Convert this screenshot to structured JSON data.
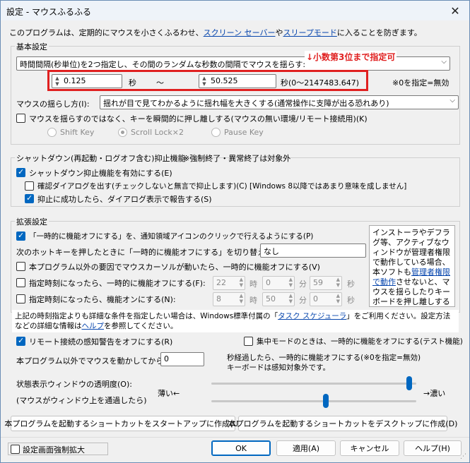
{
  "window": {
    "title": "設定 - マウスふるふる",
    "close_symbol": "✕"
  },
  "intro": {
    "text1": "このプログラムは、定期的にマウスを小さくふるわせ、",
    "link1": "スクリーン セーバー",
    "text2": "や",
    "link2": "スリープモード",
    "text3": "に入ることを防ぎます。"
  },
  "basic": {
    "label": "基本設定",
    "interval_combo": "時間間隔(秒単位)を2つ指定し、その間のランダムな秒数の間隔でマウスを揺らす:",
    "annotation": "↓小数第3位まで指定可",
    "min_value": "0.125",
    "sec_label": "秒",
    "tilde": "～",
    "max_value": "50.525",
    "range_label": "秒(0～2147483.647)",
    "zero_note": "※0を指定=無効",
    "shake_label": "マウスの揺らし方(I):",
    "shake_combo": "揺れが目で見てわかるように揺れ幅を大きくする(通常操作に支障が出る恐れあり)",
    "key_press_label": "マウスを揺らすのではなく、キーを瞬間的に押し離しする(マウスの無い環境/リモート接続用)(K)",
    "radio_shift": "Shift Key",
    "radio_scroll": "Scroll Lock×2",
    "radio_pause": "Pause Key"
  },
  "shutdown": {
    "label": "シャットダウン(再起動・ログオフ含む)抑止機能",
    "note": "※強制終了・異常終了は対象外",
    "enable_label": "シャットダウン抑止機能を有効にする(E)",
    "confirm_label": "確認ダイアログを出す(チェックしないと無言で抑止します)(C) [Windows 8以降ではあまり意味を成しません]",
    "report_label": "抑止に成功したら、ダイアログ表示で報告する(S)"
  },
  "ext": {
    "label": "拡張設定",
    "tray_label": "「一時的に機能オフにする」を、通知領域アイコンのクリックで行えるようにする(P)",
    "hotkey_label": "次のホットキーを押したときに「一時的に機能オフにする」を切り替える:",
    "hotkey_value": "なし",
    "cursor_label": "本プログラム以外の要因でマウスカーソルが動いたら、一時的に機能オフにする(V)",
    "off_time_label": "指定時刻になったら、一時的に機能オフにする(F):",
    "on_time_label": "指定時刻になったら、機能オンにする(N):",
    "off_h": "22",
    "off_m": "0",
    "off_s": "59",
    "on_h": "8",
    "on_m": "50",
    "on_s": "0",
    "unit_h": "時",
    "unit_m": "分",
    "unit_s": "秒",
    "note_text1": "インストーラやデフラグ等、アクティブなウィンドウが管理者権限で動作している場合、本ソフトも",
    "note_link": "管理者権限で動作",
    "note_text2": "させないと、マウスを揺らしたりキーボードを押し離しする機能や、左記のホットキー機能は動作しません。",
    "info_text1": "上記の時刻指定よりも詳細な条件を指定したい場合は、Windows標準付属の「",
    "info_link1": "タスク スケジューラ",
    "info_text2": "」をご利用ください。設定方法などの詳細な情報は",
    "info_link2": "ヘルプ",
    "info_text3": "を参照してください。"
  },
  "misc": {
    "remote_label": "リモート接続の感知警告をオフにする(R)",
    "focus_label": "集中モードのときは、一時的に機能をオフにする(テスト機能)",
    "idle_label": "本プログラム以外でマウスを動かしてから",
    "idle_value": "0",
    "idle_note1": "秒経過したら、一時的に機能オフにする(※0を指定=無効)",
    "idle_note2": "キーボードは感知対象外です。",
    "opacity_label": "状態表示ウィンドウの透明度(O):",
    "opacity_sub": "(マウスがウィンドウ上を通過したら)",
    "thin_label": "薄い←",
    "dark_label": "→濃い",
    "opacity_level": 0.98,
    "pass_level": 0.56,
    "startup_shortcut": "本プログラムを起動するショートカットをスタートアップに作成(U)",
    "desktop_shortcut": "本プログラムを起動するショートカットをデスクトップに作成(D)"
  },
  "footer": {
    "enlarge_label": "設定画面強制拡大",
    "ok": "OK",
    "apply": "適用(A)",
    "cancel": "キャンセル",
    "help": "ヘルプ(H)"
  },
  "colors": {
    "accent": "#0067c0",
    "annotation_red": "#e02020",
    "link": "#0645ad"
  }
}
